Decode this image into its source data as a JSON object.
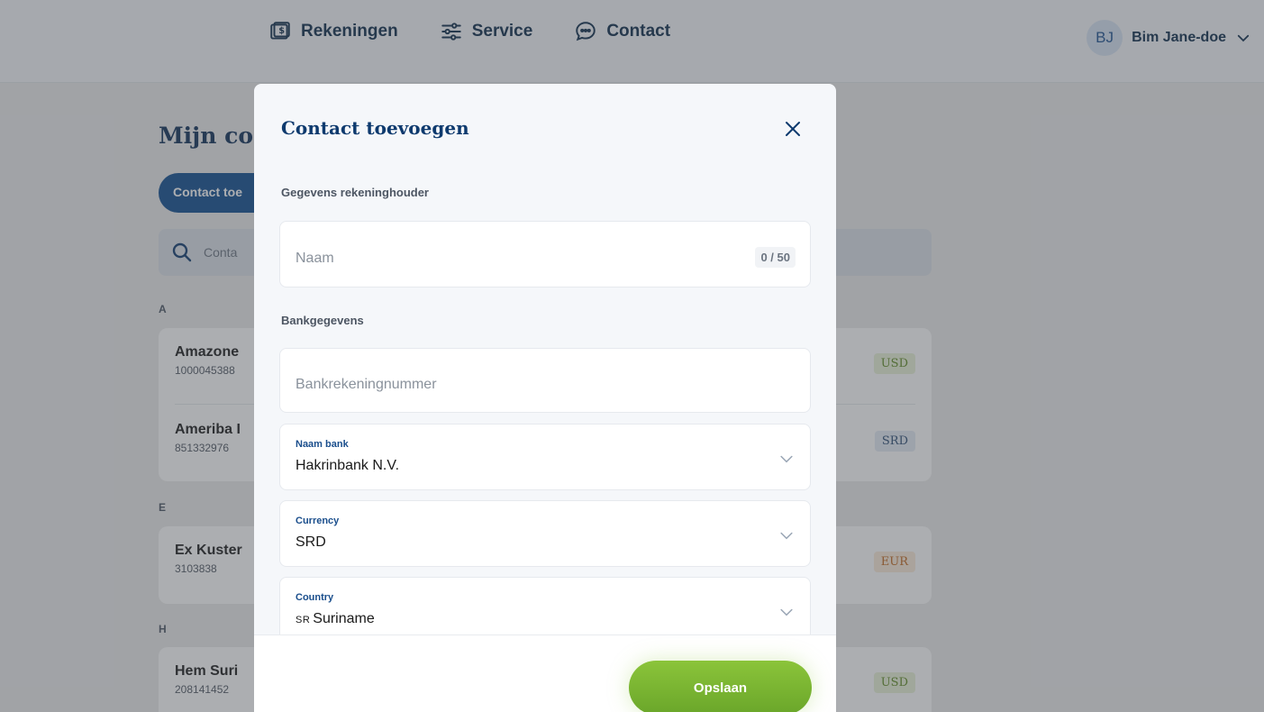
{
  "nav": {
    "items": [
      {
        "label": "Rekeningen",
        "icon": "wallet-icon"
      },
      {
        "label": "Service",
        "icon": "sliders-icon"
      },
      {
        "label": "Contact",
        "icon": "chat-bubble-icon"
      }
    ],
    "user": {
      "initials": "BJ",
      "name": "Bim Jane-doe"
    }
  },
  "page": {
    "title": "Mijn co",
    "add_button": "Contact toe",
    "search_placeholder": "Conta",
    "groups": [
      {
        "letter": "A",
        "rows": [
          {
            "name": "Amazone",
            "number": "1000045388",
            "currency": "USD"
          },
          {
            "name": "Ameriba I",
            "number": "851332976",
            "currency": "SRD"
          }
        ]
      },
      {
        "letter": "E",
        "rows": [
          {
            "name": "Ex Kuster",
            "number": "3103838",
            "currency": "EUR"
          }
        ]
      },
      {
        "letter": "H",
        "rows": [
          {
            "name": "Hem Suri",
            "number": "208141452",
            "currency": "USD"
          }
        ]
      }
    ]
  },
  "modal": {
    "title": "Contact toevoegen",
    "section_holder": "Gegevens rekeninghouder",
    "name_placeholder": "Naam",
    "name_counter": "0 / 50",
    "section_bank": "Bankgegevens",
    "account_placeholder": "Bankrekeningnummer",
    "bank": {
      "label": "Naam bank",
      "value": "Hakrinbank N.V."
    },
    "currency": {
      "label": "Currency",
      "value": "SRD"
    },
    "country": {
      "label": "Country",
      "code": "SR",
      "value": "Suriname"
    },
    "save_label": "Opslaan"
  },
  "colors": {
    "primary": "#0e4c8f",
    "title_blue": "#0e3a6e",
    "save_green": "#7ab632",
    "usd_badge": "#5f8a22",
    "eur_badge": "#c1661c"
  }
}
